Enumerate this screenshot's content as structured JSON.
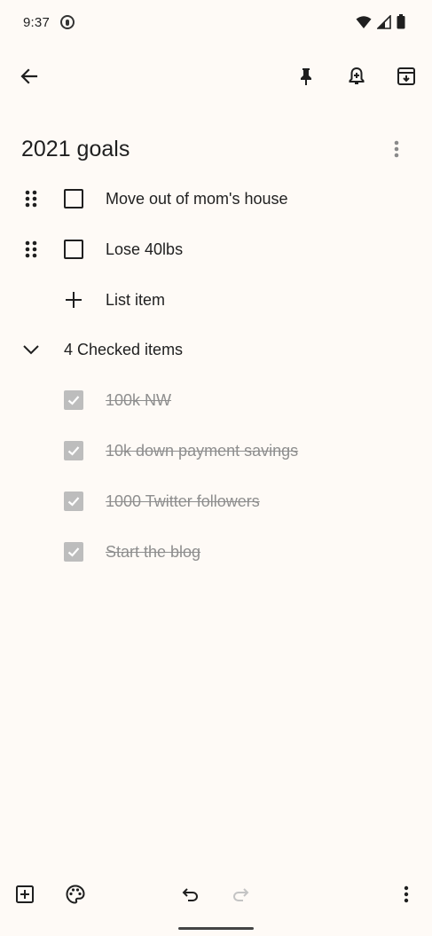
{
  "status_bar": {
    "time": "9:37"
  },
  "note": {
    "title": "2021 goals",
    "unchecked_items": [
      {
        "label": "Move out of mom's house"
      },
      {
        "label": "Lose 40lbs"
      }
    ],
    "add_item_label": "List item",
    "checked_header": "4 Checked items",
    "checked_items": [
      {
        "label": "100k NW"
      },
      {
        "label": "10k down payment savings"
      },
      {
        "label": "1000 Twitter followers"
      },
      {
        "label": "Start the blog"
      }
    ]
  },
  "colors": {
    "background": "#FEFAF6",
    "text": "#1F1F1F",
    "checked_text": "#8E8E8E",
    "checked_box": "#BDBDBD"
  },
  "icons": {
    "toolbar": [
      "back-arrow-icon",
      "pin-icon",
      "reminder-bell-icon",
      "archive-icon"
    ],
    "bottom": [
      "add-box-icon",
      "palette-icon",
      "undo-icon",
      "redo-icon",
      "more-vert-icon"
    ]
  }
}
